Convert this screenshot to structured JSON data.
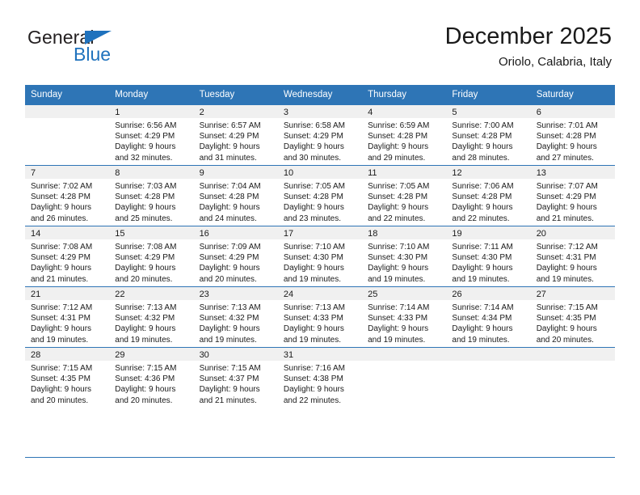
{
  "brand": {
    "name_top": "General",
    "name_bottom": "Blue",
    "triangle_color": "#1f72bd"
  },
  "header": {
    "title": "December 2025",
    "subtitle": "Oriolo, Calabria, Italy"
  },
  "theme": {
    "header_blue": "#2e75b6",
    "daynum_band": "#f0f0f0",
    "text": "#1a1a1a"
  },
  "weekday_headers": [
    "Sunday",
    "Monday",
    "Tuesday",
    "Wednesday",
    "Thursday",
    "Friday",
    "Saturday"
  ],
  "weeks": [
    [
      {
        "day": "",
        "sunrise": "",
        "sunset": "",
        "daylight_1": "",
        "daylight_2": ""
      },
      {
        "day": "1",
        "sunrise": "Sunrise: 6:56 AM",
        "sunset": "Sunset: 4:29 PM",
        "daylight_1": "Daylight: 9 hours",
        "daylight_2": "and 32 minutes."
      },
      {
        "day": "2",
        "sunrise": "Sunrise: 6:57 AM",
        "sunset": "Sunset: 4:29 PM",
        "daylight_1": "Daylight: 9 hours",
        "daylight_2": "and 31 minutes."
      },
      {
        "day": "3",
        "sunrise": "Sunrise: 6:58 AM",
        "sunset": "Sunset: 4:29 PM",
        "daylight_1": "Daylight: 9 hours",
        "daylight_2": "and 30 minutes."
      },
      {
        "day": "4",
        "sunrise": "Sunrise: 6:59 AM",
        "sunset": "Sunset: 4:28 PM",
        "daylight_1": "Daylight: 9 hours",
        "daylight_2": "and 29 minutes."
      },
      {
        "day": "5",
        "sunrise": "Sunrise: 7:00 AM",
        "sunset": "Sunset: 4:28 PM",
        "daylight_1": "Daylight: 9 hours",
        "daylight_2": "and 28 minutes."
      },
      {
        "day": "6",
        "sunrise": "Sunrise: 7:01 AM",
        "sunset": "Sunset: 4:28 PM",
        "daylight_1": "Daylight: 9 hours",
        "daylight_2": "and 27 minutes."
      }
    ],
    [
      {
        "day": "7",
        "sunrise": "Sunrise: 7:02 AM",
        "sunset": "Sunset: 4:28 PM",
        "daylight_1": "Daylight: 9 hours",
        "daylight_2": "and 26 minutes."
      },
      {
        "day": "8",
        "sunrise": "Sunrise: 7:03 AM",
        "sunset": "Sunset: 4:28 PM",
        "daylight_1": "Daylight: 9 hours",
        "daylight_2": "and 25 minutes."
      },
      {
        "day": "9",
        "sunrise": "Sunrise: 7:04 AM",
        "sunset": "Sunset: 4:28 PM",
        "daylight_1": "Daylight: 9 hours",
        "daylight_2": "and 24 minutes."
      },
      {
        "day": "10",
        "sunrise": "Sunrise: 7:05 AM",
        "sunset": "Sunset: 4:28 PM",
        "daylight_1": "Daylight: 9 hours",
        "daylight_2": "and 23 minutes."
      },
      {
        "day": "11",
        "sunrise": "Sunrise: 7:05 AM",
        "sunset": "Sunset: 4:28 PM",
        "daylight_1": "Daylight: 9 hours",
        "daylight_2": "and 22 minutes."
      },
      {
        "day": "12",
        "sunrise": "Sunrise: 7:06 AM",
        "sunset": "Sunset: 4:28 PM",
        "daylight_1": "Daylight: 9 hours",
        "daylight_2": "and 22 minutes."
      },
      {
        "day": "13",
        "sunrise": "Sunrise: 7:07 AM",
        "sunset": "Sunset: 4:29 PM",
        "daylight_1": "Daylight: 9 hours",
        "daylight_2": "and 21 minutes."
      }
    ],
    [
      {
        "day": "14",
        "sunrise": "Sunrise: 7:08 AM",
        "sunset": "Sunset: 4:29 PM",
        "daylight_1": "Daylight: 9 hours",
        "daylight_2": "and 21 minutes."
      },
      {
        "day": "15",
        "sunrise": "Sunrise: 7:08 AM",
        "sunset": "Sunset: 4:29 PM",
        "daylight_1": "Daylight: 9 hours",
        "daylight_2": "and 20 minutes."
      },
      {
        "day": "16",
        "sunrise": "Sunrise: 7:09 AM",
        "sunset": "Sunset: 4:29 PM",
        "daylight_1": "Daylight: 9 hours",
        "daylight_2": "and 20 minutes."
      },
      {
        "day": "17",
        "sunrise": "Sunrise: 7:10 AM",
        "sunset": "Sunset: 4:30 PM",
        "daylight_1": "Daylight: 9 hours",
        "daylight_2": "and 19 minutes."
      },
      {
        "day": "18",
        "sunrise": "Sunrise: 7:10 AM",
        "sunset": "Sunset: 4:30 PM",
        "daylight_1": "Daylight: 9 hours",
        "daylight_2": "and 19 minutes."
      },
      {
        "day": "19",
        "sunrise": "Sunrise: 7:11 AM",
        "sunset": "Sunset: 4:30 PM",
        "daylight_1": "Daylight: 9 hours",
        "daylight_2": "and 19 minutes."
      },
      {
        "day": "20",
        "sunrise": "Sunrise: 7:12 AM",
        "sunset": "Sunset: 4:31 PM",
        "daylight_1": "Daylight: 9 hours",
        "daylight_2": "and 19 minutes."
      }
    ],
    [
      {
        "day": "21",
        "sunrise": "Sunrise: 7:12 AM",
        "sunset": "Sunset: 4:31 PM",
        "daylight_1": "Daylight: 9 hours",
        "daylight_2": "and 19 minutes."
      },
      {
        "day": "22",
        "sunrise": "Sunrise: 7:13 AM",
        "sunset": "Sunset: 4:32 PM",
        "daylight_1": "Daylight: 9 hours",
        "daylight_2": "and 19 minutes."
      },
      {
        "day": "23",
        "sunrise": "Sunrise: 7:13 AM",
        "sunset": "Sunset: 4:32 PM",
        "daylight_1": "Daylight: 9 hours",
        "daylight_2": "and 19 minutes."
      },
      {
        "day": "24",
        "sunrise": "Sunrise: 7:13 AM",
        "sunset": "Sunset: 4:33 PM",
        "daylight_1": "Daylight: 9 hours",
        "daylight_2": "and 19 minutes."
      },
      {
        "day": "25",
        "sunrise": "Sunrise: 7:14 AM",
        "sunset": "Sunset: 4:33 PM",
        "daylight_1": "Daylight: 9 hours",
        "daylight_2": "and 19 minutes."
      },
      {
        "day": "26",
        "sunrise": "Sunrise: 7:14 AM",
        "sunset": "Sunset: 4:34 PM",
        "daylight_1": "Daylight: 9 hours",
        "daylight_2": "and 19 minutes."
      },
      {
        "day": "27",
        "sunrise": "Sunrise: 7:15 AM",
        "sunset": "Sunset: 4:35 PM",
        "daylight_1": "Daylight: 9 hours",
        "daylight_2": "and 20 minutes."
      }
    ],
    [
      {
        "day": "28",
        "sunrise": "Sunrise: 7:15 AM",
        "sunset": "Sunset: 4:35 PM",
        "daylight_1": "Daylight: 9 hours",
        "daylight_2": "and 20 minutes."
      },
      {
        "day": "29",
        "sunrise": "Sunrise: 7:15 AM",
        "sunset": "Sunset: 4:36 PM",
        "daylight_1": "Daylight: 9 hours",
        "daylight_2": "and 20 minutes."
      },
      {
        "day": "30",
        "sunrise": "Sunrise: 7:15 AM",
        "sunset": "Sunset: 4:37 PM",
        "daylight_1": "Daylight: 9 hours",
        "daylight_2": "and 21 minutes."
      },
      {
        "day": "31",
        "sunrise": "Sunrise: 7:16 AM",
        "sunset": "Sunset: 4:38 PM",
        "daylight_1": "Daylight: 9 hours",
        "daylight_2": "and 22 minutes."
      },
      {
        "day": "",
        "sunrise": "",
        "sunset": "",
        "daylight_1": "",
        "daylight_2": ""
      },
      {
        "day": "",
        "sunrise": "",
        "sunset": "",
        "daylight_1": "",
        "daylight_2": ""
      },
      {
        "day": "",
        "sunrise": "",
        "sunset": "",
        "daylight_1": "",
        "daylight_2": ""
      }
    ]
  ]
}
